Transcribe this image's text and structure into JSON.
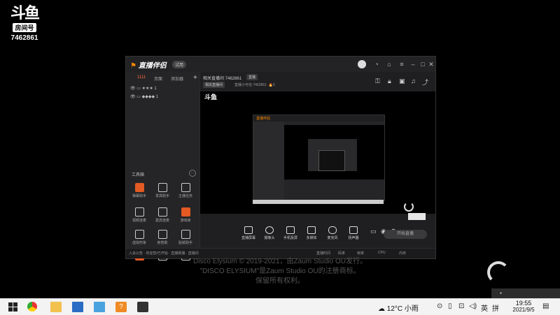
{
  "watermark": {
    "logo": "斗鱼",
    "tag": "房间号",
    "room_id": "7462861"
  },
  "app": {
    "brand": "直播伴侣",
    "beta": "试用",
    "sidebar": {
      "tabs": [
        "1111",
        "页面",
        "添加器"
      ],
      "scenes": [
        "★★★ 1",
        "◆◆◆◆ 1"
      ],
      "tools_title": "工具箱",
      "tools": [
        {
          "label": "弹幕助手",
          "accent": true
        },
        {
          "label": "贵宾助手",
          "accent": false
        },
        {
          "label": "主播任务",
          "accent": false
        },
        {
          "label": "视频连麦",
          "accent": false
        },
        {
          "label": "嘉宾连麦",
          "accent": false
        },
        {
          "label": "游戏库",
          "accent": true
        },
        {
          "label": "虚拟形象",
          "accent": false
        },
        {
          "label": "房管助",
          "accent": false
        },
        {
          "label": "贴纸助手",
          "accent": false
        },
        {
          "label": "直播分",
          "accent": false
        },
        {
          "label": "",
          "accent": false
        },
        {
          "label": "",
          "accent": false
        }
      ],
      "bottom": [
        "入会公告",
        "欢迎您/已开始",
        "直播助播",
        "直播间"
      ]
    },
    "room": {
      "title": "相关直播间 7462861",
      "tag": "直播",
      "category": "相关直播间",
      "info": "直播小可信 7462861",
      "count": "0"
    },
    "controls": [
      "直播屏幕",
      "摄像头",
      "手机投屏",
      "多媒体",
      "麦克风",
      "扬声器"
    ],
    "start_label": "开始直播",
    "status": [
      "直播时间",
      "码率",
      "帧率",
      "CPU",
      "内存"
    ]
  },
  "copyright": [
    "Disco Elysium © 2019-2021，由Zaum Studio OU发行。",
    "\"DISCO ELYSIUM\"是Zaum Studio OU的注册商标。",
    "保留所有权利。"
  ],
  "taskbar": {
    "weather": "12°C 小雨",
    "tray_lang": "英",
    "ime": "拼",
    "time": "19:55",
    "date": "2021/9/5"
  }
}
